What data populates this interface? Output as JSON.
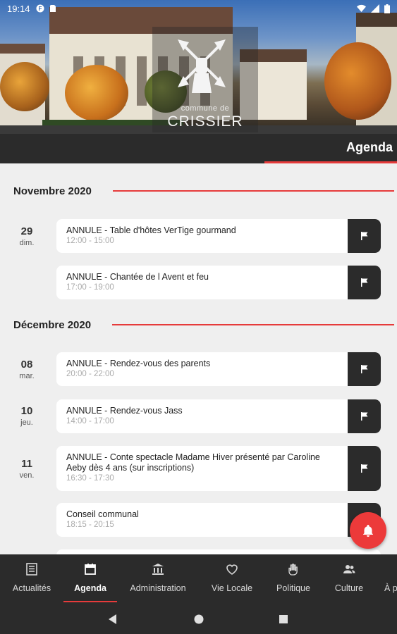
{
  "status_bar": {
    "time": "19:14"
  },
  "header": {
    "logo_small": "commune de",
    "logo_big": "CRISSIER"
  },
  "page": {
    "title": "Agenda"
  },
  "agenda": {
    "months": [
      {
        "label": "Novembre 2020",
        "events": [
          {
            "day": "29",
            "weekday": "dim.",
            "title": "ANNULE - Table d'hôtes VerTige gourmand",
            "time": "12:00 - 15:00"
          },
          {
            "day": "",
            "weekday": "",
            "title": "ANNULE - Chantée de l Avent et feu",
            "time": "17:00 - 19:00"
          }
        ]
      },
      {
        "label": "Décembre 2020",
        "events": [
          {
            "day": "08",
            "weekday": "mar.",
            "title": "ANNULE - Rendez-vous des parents",
            "time": "20:00 - 22:00"
          },
          {
            "day": "10",
            "weekday": "jeu.",
            "title": "ANNULE - Rendez-vous Jass",
            "time": "14:00 - 17:00"
          },
          {
            "day": "11",
            "weekday": "ven.",
            "title": "ANNULE - Conte spectacle Madame Hiver présenté par Caroline Aeby dès 4 ans (sur inscriptions)",
            "time": "16:30 - 17:30"
          },
          {
            "day": "",
            "weekday": "",
            "title": "Conseil communal",
            "time": "18:15 - 20:15"
          }
        ]
      }
    ]
  },
  "bottom_nav": {
    "items": [
      {
        "label": "Actualités",
        "icon": "newspaper-icon"
      },
      {
        "label": "Agenda",
        "icon": "calendar-icon",
        "active": true
      },
      {
        "label": "Administration",
        "icon": "bank-icon"
      },
      {
        "label": "Vie Locale",
        "icon": "heart-icon"
      },
      {
        "label": "Politique",
        "icon": "raised-hand-icon"
      },
      {
        "label": "Culture",
        "icon": "people-icon"
      },
      {
        "label": "À p",
        "icon": ""
      }
    ]
  },
  "colors": {
    "accent": "#e63b3b",
    "dark": "#2b2b2b",
    "fab": "#ec3a3a"
  }
}
